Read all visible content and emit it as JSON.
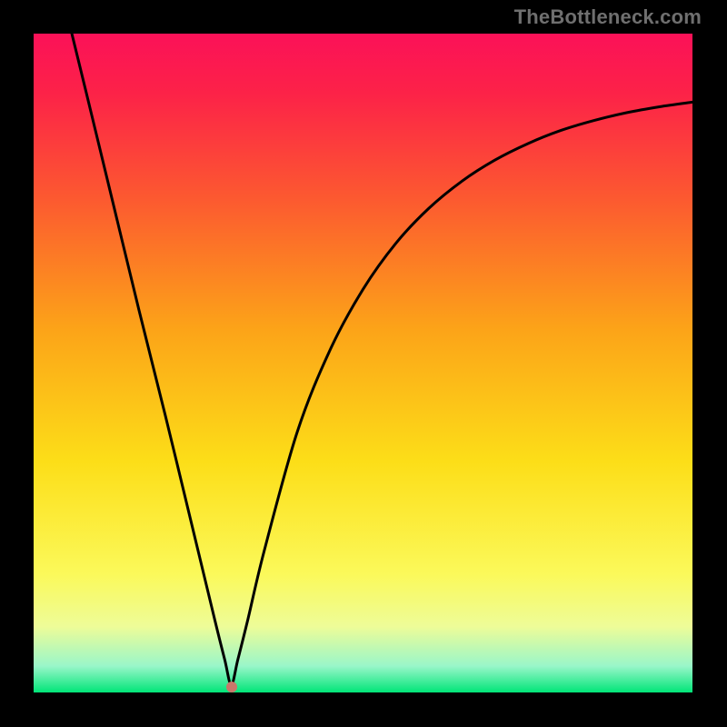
{
  "watermark": "TheBottleneck.com",
  "marker": {
    "x_frac": 0.301,
    "y_frac": 0.992,
    "color": "#c9776a"
  },
  "curve_stroke": "#000000",
  "curve_stroke_width": 3,
  "chart_data": {
    "type": "line",
    "title": "",
    "xlabel": "",
    "ylabel": "",
    "xlim": [
      0,
      1
    ],
    "ylim": [
      0,
      1
    ],
    "series": [
      {
        "name": "curve",
        "x": [
          0.058,
          0.08,
          0.12,
          0.16,
          0.2,
          0.24,
          0.275,
          0.29,
          0.3,
          0.31,
          0.325,
          0.35,
          0.4,
          0.45,
          0.5,
          0.55,
          0.6,
          0.65,
          0.7,
          0.75,
          0.8,
          0.85,
          0.9,
          0.95,
          1.0
        ],
        "y": [
          1.0,
          0.91,
          0.745,
          0.58,
          0.42,
          0.255,
          0.11,
          0.05,
          0.012,
          0.05,
          0.11,
          0.215,
          0.395,
          0.52,
          0.612,
          0.682,
          0.735,
          0.776,
          0.808,
          0.833,
          0.853,
          0.868,
          0.88,
          0.889,
          0.896
        ]
      }
    ],
    "gradient_stops": [
      {
        "t": 0.0,
        "color": "#fb1158"
      },
      {
        "t": 0.09,
        "color": "#fc2248"
      },
      {
        "t": 0.25,
        "color": "#fc5930"
      },
      {
        "t": 0.45,
        "color": "#fca418"
      },
      {
        "t": 0.65,
        "color": "#fcde18"
      },
      {
        "t": 0.82,
        "color": "#fbf95a"
      },
      {
        "t": 0.9,
        "color": "#eefc98"
      },
      {
        "t": 0.96,
        "color": "#99f6c9"
      },
      {
        "t": 1.0,
        "color": "#01e578"
      }
    ]
  }
}
